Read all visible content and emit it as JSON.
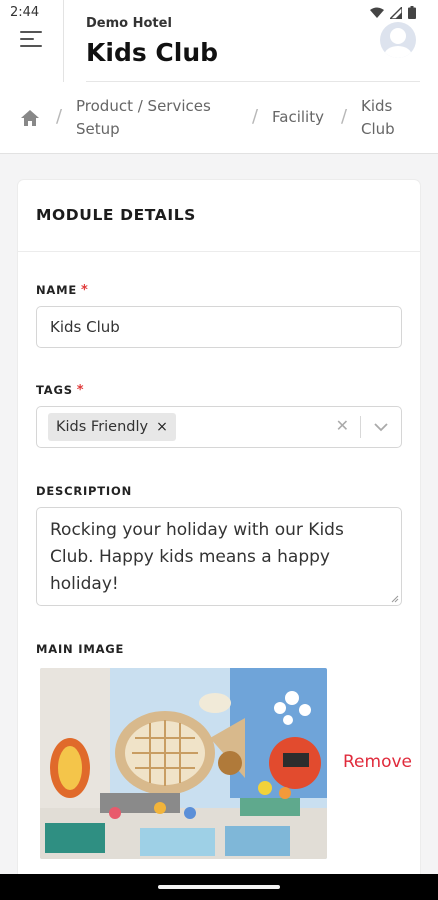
{
  "status_bar": {
    "time": "2:44"
  },
  "header": {
    "hotel_name": "Demo Hotel",
    "title": "Kids Club"
  },
  "breadcrumb": {
    "items": [
      {
        "label": "Product / Services Setup"
      },
      {
        "label": "Facility"
      },
      {
        "label": "Kids Club"
      }
    ],
    "separator": "/"
  },
  "card": {
    "title": "MODULE DETAILS",
    "required_mark": "*",
    "name_field": {
      "label": "NAME",
      "value": "Kids Club"
    },
    "tags_field": {
      "label": "TAGS",
      "tags": [
        {
          "label": "Kids Friendly",
          "remove": "×"
        }
      ],
      "clear": "✕"
    },
    "description_field": {
      "label": "DESCRIPTION",
      "value": "Rocking your holiday with our Kids Club. Happy kids means a happy holiday!"
    },
    "main_image": {
      "label": "MAIN IMAGE",
      "remove_label": "Remove"
    }
  },
  "colors": {
    "accent_red": "#e02a3b",
    "required_red": "#e03a3a",
    "background": "#f4f4f5",
    "card": "#ffffff"
  },
  "icons": [
    "menu-icon",
    "avatar-icon",
    "home-icon",
    "wifi-icon",
    "signal-icon",
    "battery-icon",
    "chevron-down-icon",
    "close-icon"
  ]
}
